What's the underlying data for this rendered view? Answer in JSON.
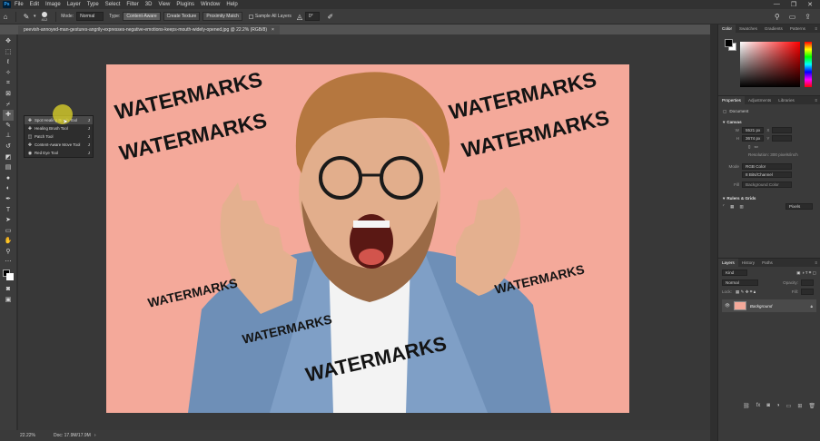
{
  "app": {
    "logo": "Ps"
  },
  "menu": [
    "File",
    "Edit",
    "Image",
    "Layer",
    "Type",
    "Select",
    "Filter",
    "3D",
    "View",
    "Plugins",
    "Window",
    "Help"
  ],
  "window_controls": [
    "—",
    "❐",
    "✕"
  ],
  "options": {
    "brush_size": "412",
    "mode_label": "Mode:",
    "mode_value": "Normal",
    "type_label": "Type:",
    "type_buttons": [
      "Content-Aware",
      "Create Texture",
      "Proximity Match"
    ],
    "sample_all_layers": "Sample All Layers",
    "angle": "0°"
  },
  "document_tab": {
    "title": "peevish-annoyed-man-gestures-angrily-expresses-negative-emotions-keeps-mouth-widely-opened.jpg @ 22.2% (RGB/8)",
    "close": "×"
  },
  "tool_flyout": [
    {
      "label": "Spot Healing Brush Tool",
      "key": "J",
      "icon": "spot-healing-icon"
    },
    {
      "label": "Healing Brush Tool",
      "key": "J",
      "icon": "healing-brush-icon"
    },
    {
      "label": "Patch Tool",
      "key": "J",
      "icon": "patch-icon"
    },
    {
      "label": "Content-Aware Move Tool",
      "key": "J",
      "icon": "content-aware-move-icon"
    },
    {
      "label": "Red Eye Tool",
      "key": "J",
      "icon": "red-eye-icon"
    }
  ],
  "watermark_text": "WATERMARKS",
  "status": {
    "zoom": "22.22%",
    "doc": "Doc: 17.9M/17.9M"
  },
  "panels": {
    "color_tabs": [
      "Color",
      "Swatches",
      "Gradients",
      "Patterns"
    ],
    "props_tabs": [
      "Properties",
      "Adjustments",
      "Libraries"
    ],
    "document_label": "Document",
    "canvas_head": "Canvas",
    "width_label": "W",
    "width_value": "5521 px",
    "height_label": "H",
    "height_value": "3674 px",
    "x_label": "X",
    "y_label": "Y",
    "resolution": "Resolution: 300 pixels/inch",
    "mode_label": "Mode",
    "mode_value": "RGB Color",
    "bit_value": "8 Bits/Channel",
    "fill_label": "Fill",
    "fill_value": "Background Color",
    "rulers_head": "Rulers & Grids",
    "rulers_units": "Pixels",
    "layers_tabs": [
      "Layers",
      "History",
      "Paths"
    ],
    "layer_kind": "Kind",
    "layer_mode": "Normal",
    "opacity_label": "Opacity:",
    "lock_label": "Lock:",
    "fill_label2": "Fill:",
    "layer_name": "Background"
  }
}
